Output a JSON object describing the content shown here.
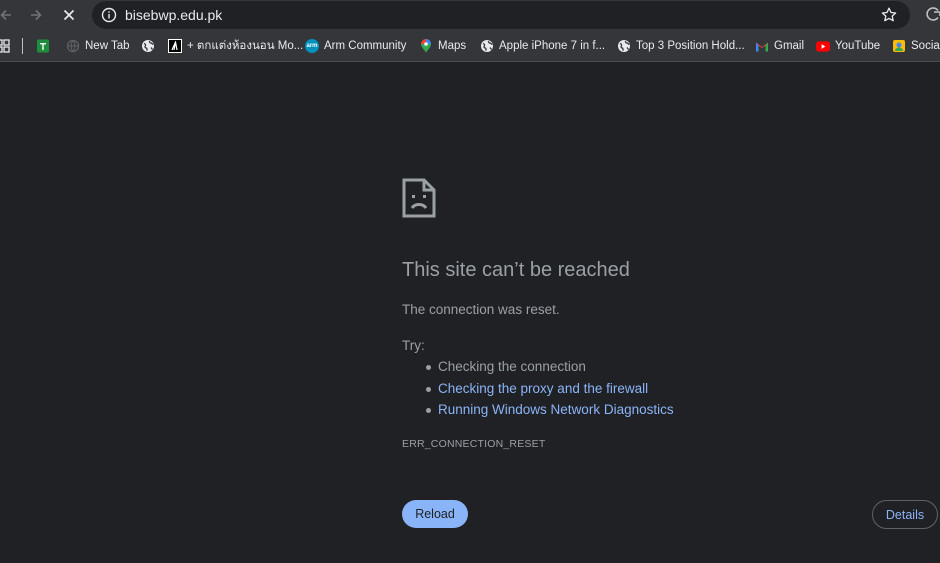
{
  "toolbar": {
    "url": "bisebwp.edu.pk"
  },
  "bookmarks": {
    "items": [
      {
        "label": "New Tab",
        "icon": "newtab-icon"
      },
      {
        "label": "+ ตกแต่งห้องนอน Mo...",
        "icon": "bookmark-a-icon"
      },
      {
        "label": "Arm Community",
        "icon": "arm-icon"
      },
      {
        "label": "Maps",
        "icon": "maps-pin-icon"
      },
      {
        "label": "Apple iPhone 7 in f...",
        "icon": "globe-icon"
      },
      {
        "label": "Top 3 Position Hold...",
        "icon": "globe-icon"
      },
      {
        "label": "Gmail",
        "icon": "gmail-icon"
      },
      {
        "label": "YouTube",
        "icon": "youtube-icon"
      },
      {
        "label": "Social",
        "icon": "social-icon"
      }
    ],
    "arm_badge": "arm"
  },
  "error": {
    "title": "This site can’t be reached",
    "subtitle": "The connection was reset.",
    "try_label": "Try:",
    "suggestions": [
      {
        "text": "Checking the connection",
        "is_link": false
      },
      {
        "text": "Checking the proxy and the firewall",
        "is_link": true
      },
      {
        "text": "Running Windows Network Diagnostics",
        "is_link": true
      }
    ],
    "code": "ERR_CONNECTION_RESET",
    "reload_label": "Reload",
    "details_label": "Details"
  },
  "colors": {
    "background": "#202124",
    "toolbar": "#35363a",
    "text": "#9aa0a6",
    "link": "#8ab4f8",
    "reload_bg": "#8ab4f8"
  }
}
